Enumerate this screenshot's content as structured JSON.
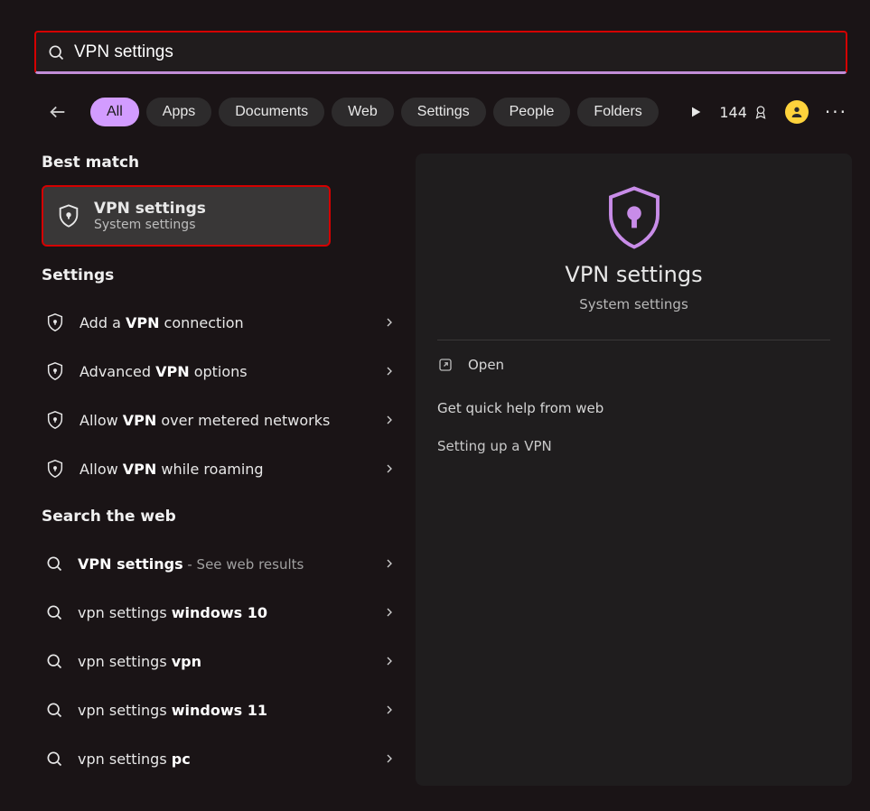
{
  "search": {
    "query": "VPN settings"
  },
  "filters": {
    "items": [
      "All",
      "Apps",
      "Documents",
      "Web",
      "Settings",
      "People",
      "Folders"
    ],
    "active": 0
  },
  "points": "144",
  "sections": {
    "best_match": "Best match",
    "settings": "Settings",
    "web": "Search the web"
  },
  "best_match": {
    "title": "VPN settings",
    "subtitle": "System settings"
  },
  "settings_items": [
    {
      "pre": "Add a ",
      "bold": "VPN",
      "post": " connection"
    },
    {
      "pre": "Advanced ",
      "bold": "VPN",
      "post": " options"
    },
    {
      "pre": "Allow ",
      "bold": "VPN",
      "post": " over metered networks"
    },
    {
      "pre": "Allow ",
      "bold": "VPN",
      "post": " while roaming"
    }
  ],
  "web_items": [
    {
      "bold": "VPN settings",
      "post": "",
      "dim": " - See web results"
    },
    {
      "pre": "vpn settings ",
      "bold": "windows 10",
      "post": ""
    },
    {
      "pre": "vpn settings ",
      "bold": "vpn",
      "post": ""
    },
    {
      "pre": "vpn settings ",
      "bold": "windows 11",
      "post": ""
    },
    {
      "pre": "vpn settings ",
      "bold": "pc",
      "post": ""
    }
  ],
  "preview": {
    "title": "VPN settings",
    "subtitle": "System settings",
    "open": "Open",
    "help_heading": "Get quick help from web",
    "help_link": "Setting up a VPN"
  }
}
